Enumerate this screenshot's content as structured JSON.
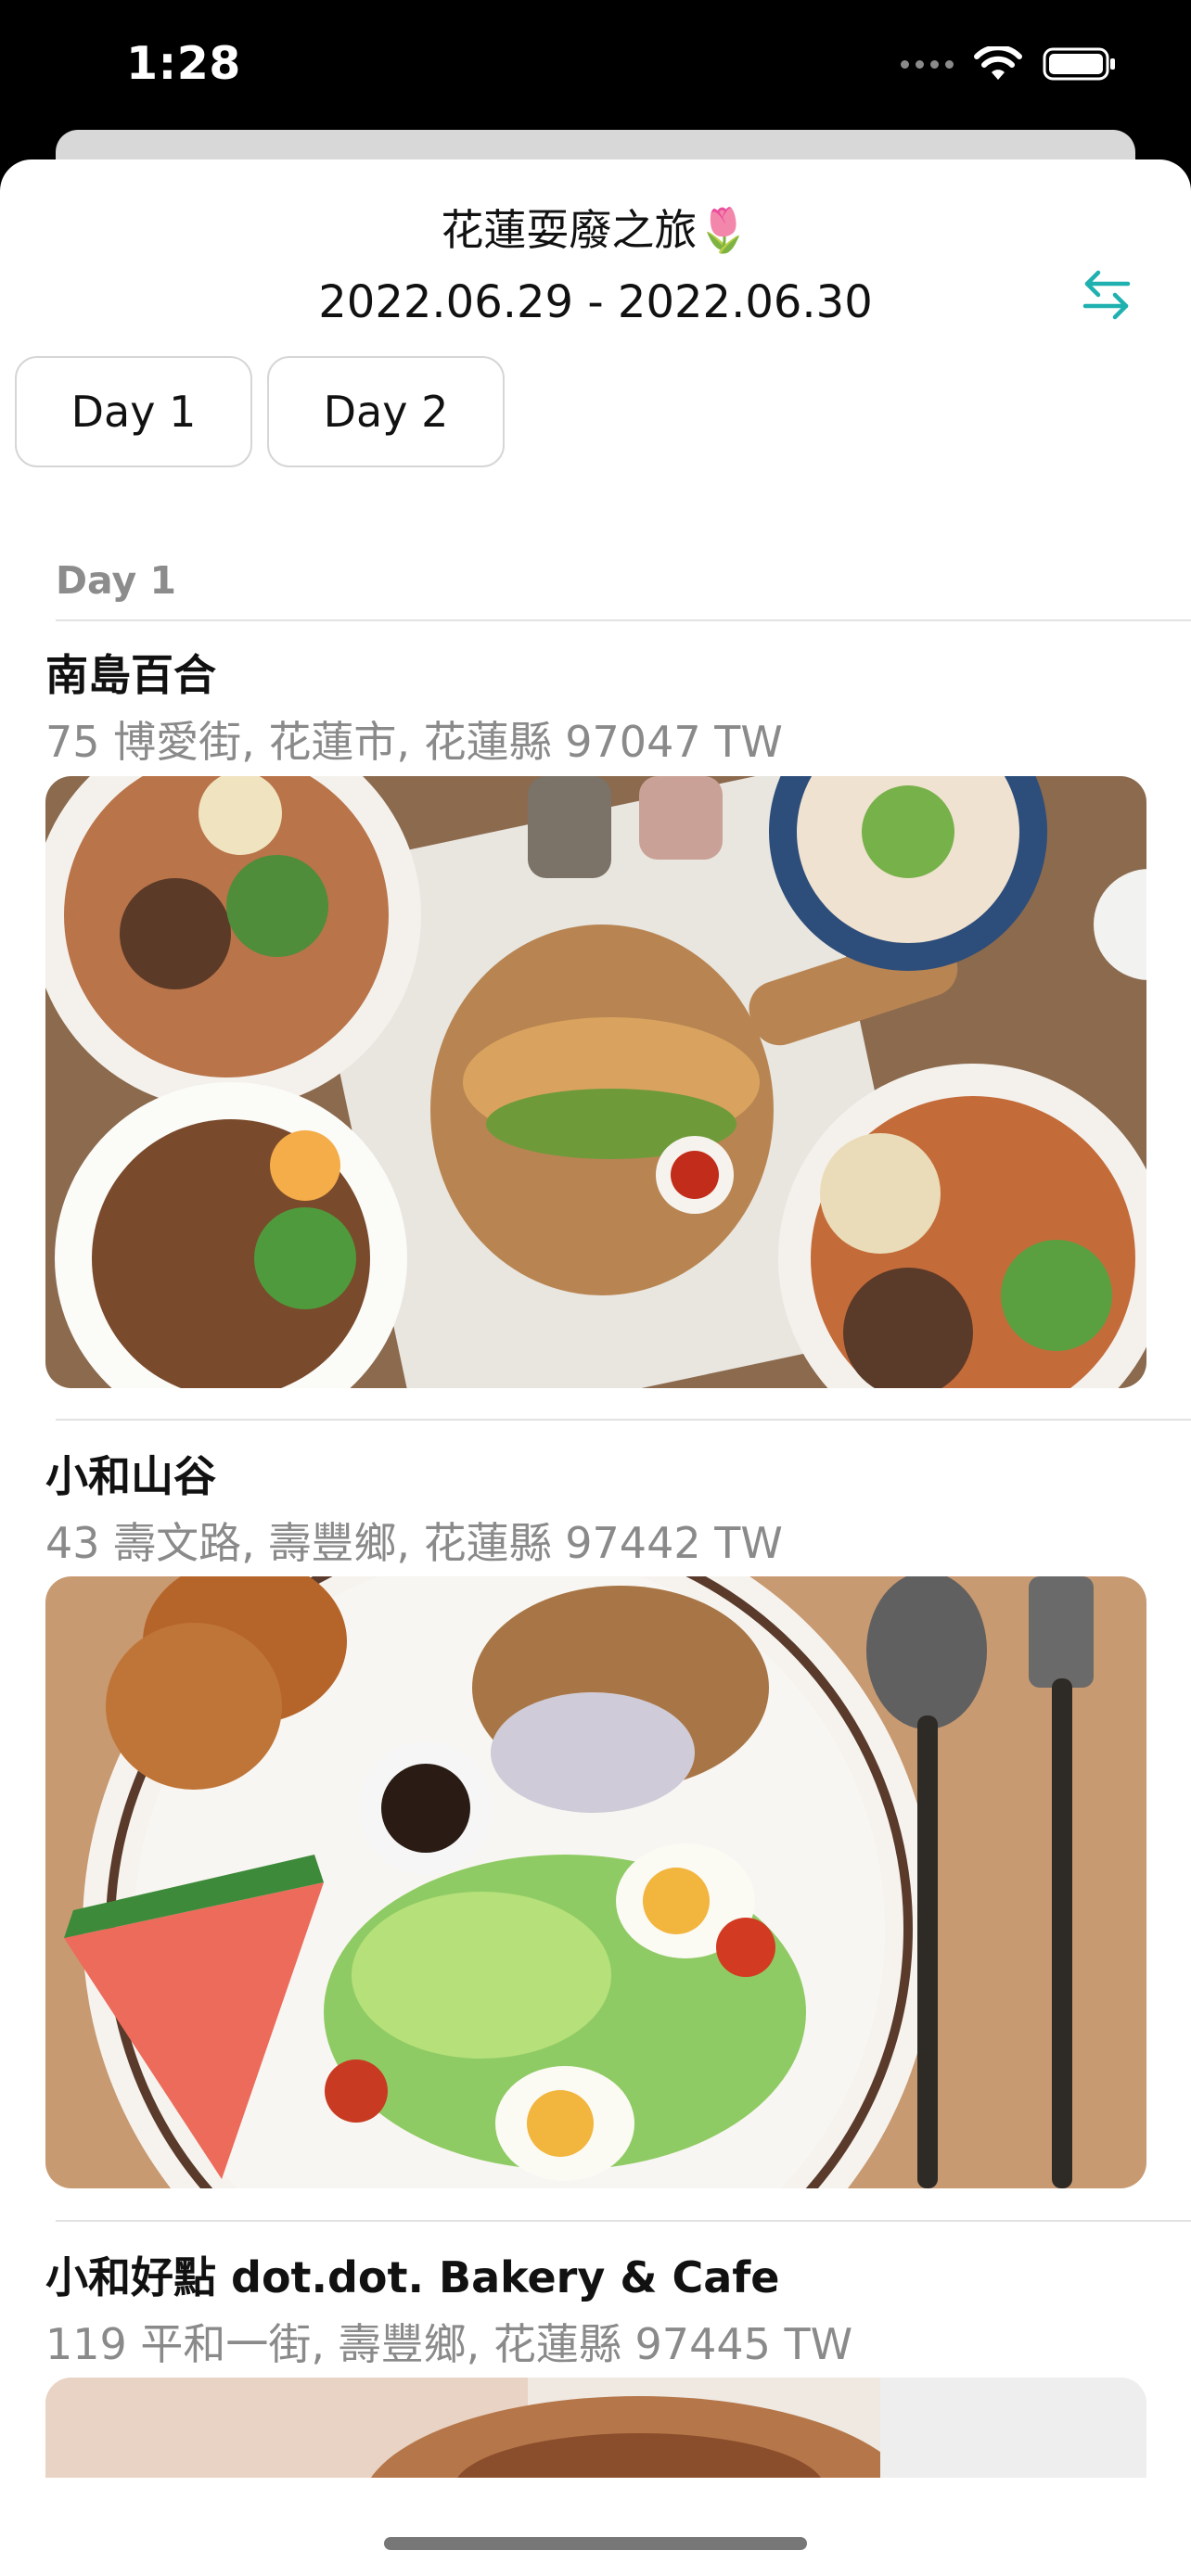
{
  "status_bar": {
    "time": "1:28"
  },
  "header": {
    "title": "花蓮耍廢之旅🌷",
    "dates": "2022.06.29 - 2022.06.30",
    "swap_icon": "arrows-swap-icon"
  },
  "day_tabs": [
    {
      "label": "Day 1"
    },
    {
      "label": "Day 2"
    }
  ],
  "section": {
    "title": "Day 1"
  },
  "places": [
    {
      "name": "南島百合",
      "address": "75 博愛街, 花蓮市, 花蓮縣 97047 TW",
      "photo": "noodle-table-spread"
    },
    {
      "name": "小和山谷",
      "address": "43 壽文路, 壽豐鄉, 花蓮縣 97442 TW",
      "photo": "brunch-plate"
    },
    {
      "name": "小和好點 dot.dot. Bakery & Cafe",
      "address": "119 平和一街, 壽豐鄉, 花蓮縣 97445 TW",
      "photo": "bakery-cafe"
    }
  ],
  "colors": {
    "accent": "#1fb0b0",
    "secondary_text": "#8a8a8a",
    "divider": "#e2e2e2"
  }
}
